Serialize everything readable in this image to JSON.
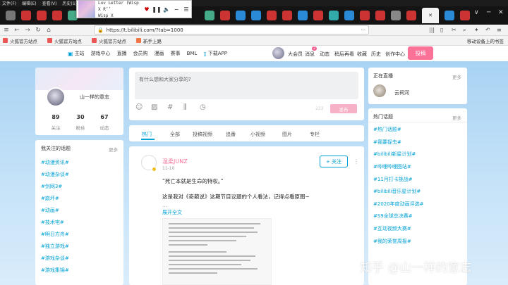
{
  "os_menu": [
    "文件(F)",
    "编辑(E)",
    "查看(V)",
    "历史(S)"
  ],
  "media": {
    "title": "Luv Letter (Wisp X R’’",
    "artist": "Wisp  X"
  },
  "address": {
    "url": "https://t.bilibili.com/?tab=1000",
    "more": "···"
  },
  "bookmarks": [
    "火狐官方站点",
    "火狐官方站点",
    "火狐官方站点",
    "新手上路"
  ],
  "bookmark_mobile": "移动设备上的书签",
  "bili_nav": [
    "主站",
    "游戏中心",
    "直播",
    "会员购",
    "漫画",
    "赛事",
    "BML",
    "下载APP"
  ],
  "bili_right": {
    "vip": "大会员",
    "msg": "消息",
    "msg_badge": "2",
    "dynamic": "动态",
    "later": "稍后再看",
    "fav": "收藏",
    "history": "历史",
    "creator": "创作中心",
    "upload": "投稿"
  },
  "profile": {
    "name": "山一样的意志",
    "stats": [
      {
        "num": "89",
        "label": "关注"
      },
      {
        "num": "30",
        "label": "粉丝"
      },
      {
        "num": "67",
        "label": "动态"
      }
    ]
  },
  "topics": {
    "title": "我关注的话题",
    "more": "更多",
    "items": [
      "#动漫资讯#",
      "#动漫杂谈#",
      "#剑网3#",
      "#崩坏#",
      "#动画#",
      "#技术宅#",
      "#明日方舟#",
      "#独立游戏#",
      "#游戏杂谈#",
      "#游戏集锦#"
    ]
  },
  "post": {
    "placeholder": "有什么想和大家分享的?",
    "count": "233",
    "submit": "发布"
  },
  "tabs": [
    "热门",
    "全部",
    "投稿视频",
    "追番",
    "小视频",
    "图片",
    "专栏"
  ],
  "feed": {
    "user": "温柔JUNZ",
    "time": "11-10",
    "follow": "+ 关注",
    "text1": "“死亡本就是生命的特权。”",
    "text2": "这是我对《奇葩说》这期节目议题的个人看法，记得点看原图~",
    "ellipsis": "...",
    "expand": "展开全文"
  },
  "live": {
    "title": "正在直播",
    "more": "更多",
    "name": "云祠河"
  },
  "hot": {
    "title": "热门话题",
    "more": "更多",
    "items": [
      "#热门话题#",
      "#我要捉虫#",
      "#bilibili新星计划#",
      "#哔哩哔哩图站#",
      "#11月打卡挑战#",
      "#bilibili音乐星计划#",
      "#2020年度动画评选#",
      "#S9全球总决赛#",
      "#互动视频大赛#",
      "#我的荣誉周报#"
    ]
  },
  "watermark": "知乎 @山一样的意志"
}
